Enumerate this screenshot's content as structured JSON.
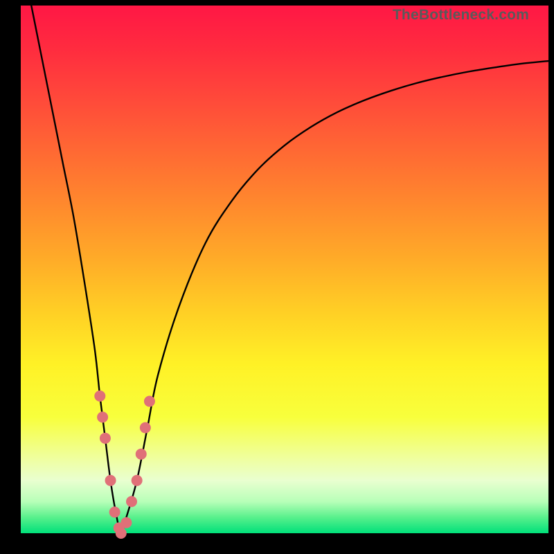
{
  "watermark": "TheBottleneck.com",
  "chart_data": {
    "type": "line",
    "title": "",
    "xlabel": "",
    "ylabel": "",
    "xlim": [
      0,
      100
    ],
    "ylim": [
      0,
      100
    ],
    "series": [
      {
        "name": "bottleneck-curve",
        "x": [
          2,
          4,
          6,
          8,
          10,
          12,
          14,
          15,
          16,
          17,
          18,
          19,
          20,
          22,
          24,
          26,
          30,
          35,
          40,
          45,
          50,
          55,
          60,
          65,
          70,
          75,
          80,
          85,
          90,
          95,
          100
        ],
        "y": [
          100,
          90,
          80,
          70,
          60,
          48,
          35,
          26,
          18,
          10,
          4,
          0,
          3,
          10,
          20,
          30,
          43,
          55,
          63,
          69,
          73.5,
          77,
          79.8,
          82,
          83.8,
          85.3,
          86.5,
          87.5,
          88.3,
          89,
          89.5
        ]
      }
    ],
    "markers": {
      "name": "highlight-points",
      "color": "#e07078",
      "radius_px": 8,
      "x": [
        15.0,
        15.5,
        16.0,
        17.0,
        17.8,
        18.6,
        19.0,
        20.0,
        21.0,
        22.0,
        22.8,
        23.6,
        24.4
      ],
      "y": [
        26,
        22,
        18,
        10,
        4,
        1,
        0,
        2,
        6,
        10,
        15,
        20,
        25
      ]
    }
  }
}
